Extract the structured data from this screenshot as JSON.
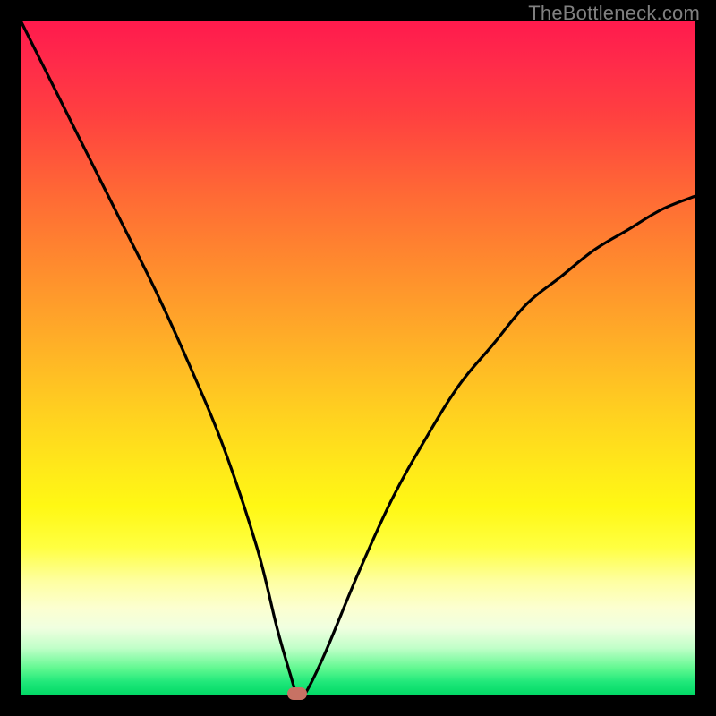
{
  "watermark": "TheBottleneck.com",
  "colors": {
    "frame": "#000000",
    "gradient_top": "#ff1a4d",
    "gradient_bottom": "#00d865",
    "curve": "#000000",
    "dot": "#c77264",
    "watermark": "#808080"
  },
  "chart_data": {
    "type": "line",
    "title": "",
    "xlabel": "",
    "ylabel": "",
    "xlim": [
      0,
      100
    ],
    "ylim": [
      0,
      100
    ],
    "grid": false,
    "series": [
      {
        "name": "bottleneck-curve",
        "x": [
          0,
          5,
          10,
          15,
          20,
          25,
          30,
          35,
          38,
          40,
          41,
          42,
          45,
          50,
          55,
          60,
          65,
          70,
          75,
          80,
          85,
          90,
          95,
          100
        ],
        "values": [
          100,
          90,
          80,
          70,
          60,
          49,
          37,
          22,
          10,
          3,
          0,
          0,
          6,
          18,
          29,
          38,
          46,
          52,
          58,
          62,
          66,
          69,
          72,
          74
        ]
      }
    ],
    "marker": {
      "x": 41,
      "y": 0
    }
  }
}
